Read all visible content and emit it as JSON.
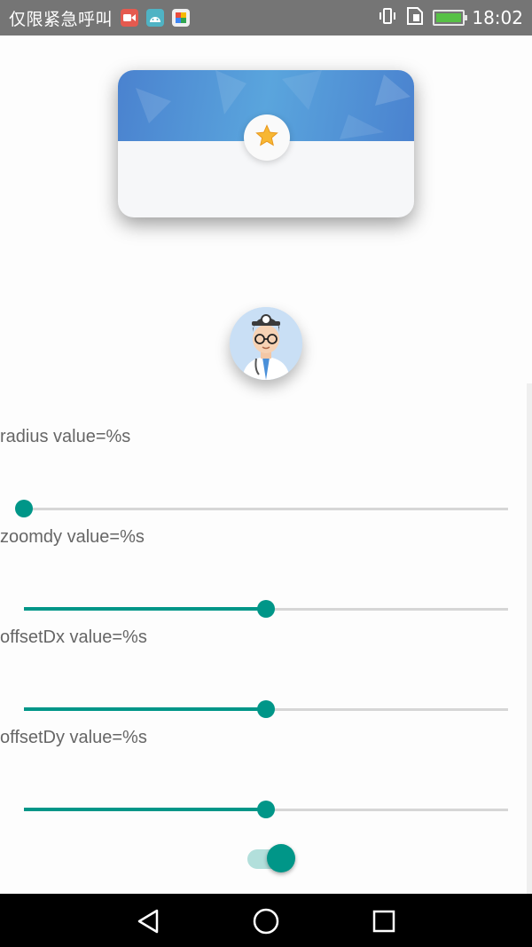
{
  "status_bar": {
    "text": "仅限紧急呼叫",
    "time": "18:02",
    "notification_icons": [
      "video-camera-icon",
      "android-icon",
      "photos-icon"
    ],
    "right_icons": [
      "vibrate-icon",
      "sim-card-icon",
      "battery-charging-icon"
    ]
  },
  "card": {
    "badge_icon": "star-icon",
    "header_color": "#4a82cf"
  },
  "avatar": {
    "icon": "doctor-avatar-icon"
  },
  "controls": [
    {
      "label": "radius  value=%s",
      "progress": 0.0
    },
    {
      "label": "zoomdy  value=%s",
      "progress": 0.5
    },
    {
      "label": "offsetDx  value=%s",
      "progress": 0.5
    },
    {
      "label": "offsetDy value=%s",
      "progress": 0.5
    }
  ],
  "switch": {
    "checked": true
  },
  "nav_bar": {
    "buttons": [
      "back-icon",
      "home-icon",
      "recents-icon"
    ]
  },
  "colors": {
    "accent": "#009688",
    "status_bar": "#757575",
    "nav_bar": "#000000"
  }
}
